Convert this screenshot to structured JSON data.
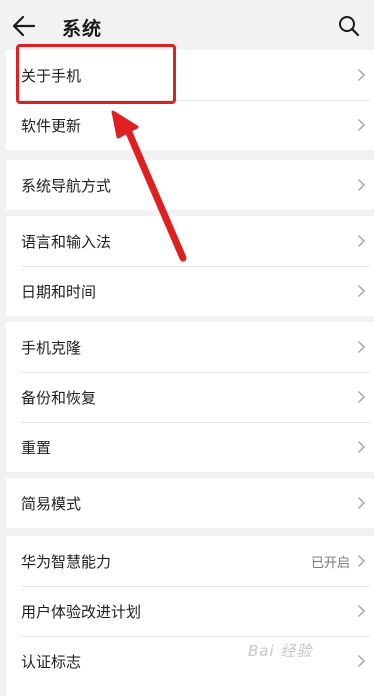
{
  "header": {
    "title": "系统",
    "back_icon": "arrow-left-icon",
    "search_icon": "search-icon"
  },
  "groups": [
    {
      "items": [
        {
          "label": "关于手机"
        },
        {
          "label": "软件更新"
        }
      ]
    },
    {
      "items": [
        {
          "label": "系统导航方式"
        }
      ]
    },
    {
      "items": [
        {
          "label": "语言和输入法"
        },
        {
          "label": "日期和时间"
        }
      ]
    },
    {
      "items": [
        {
          "label": "手机克隆"
        },
        {
          "label": "备份和恢复"
        },
        {
          "label": "重置"
        }
      ]
    },
    {
      "items": [
        {
          "label": "简易模式"
        }
      ]
    },
    {
      "items": [
        {
          "label": "华为智慧能力",
          "value": "已开启"
        },
        {
          "label": "用户体验改进计划"
        },
        {
          "label": "认证标志"
        }
      ]
    }
  ],
  "annotation": {
    "color": "#e02020"
  },
  "watermark": {
    "text": "Bai 经验"
  }
}
